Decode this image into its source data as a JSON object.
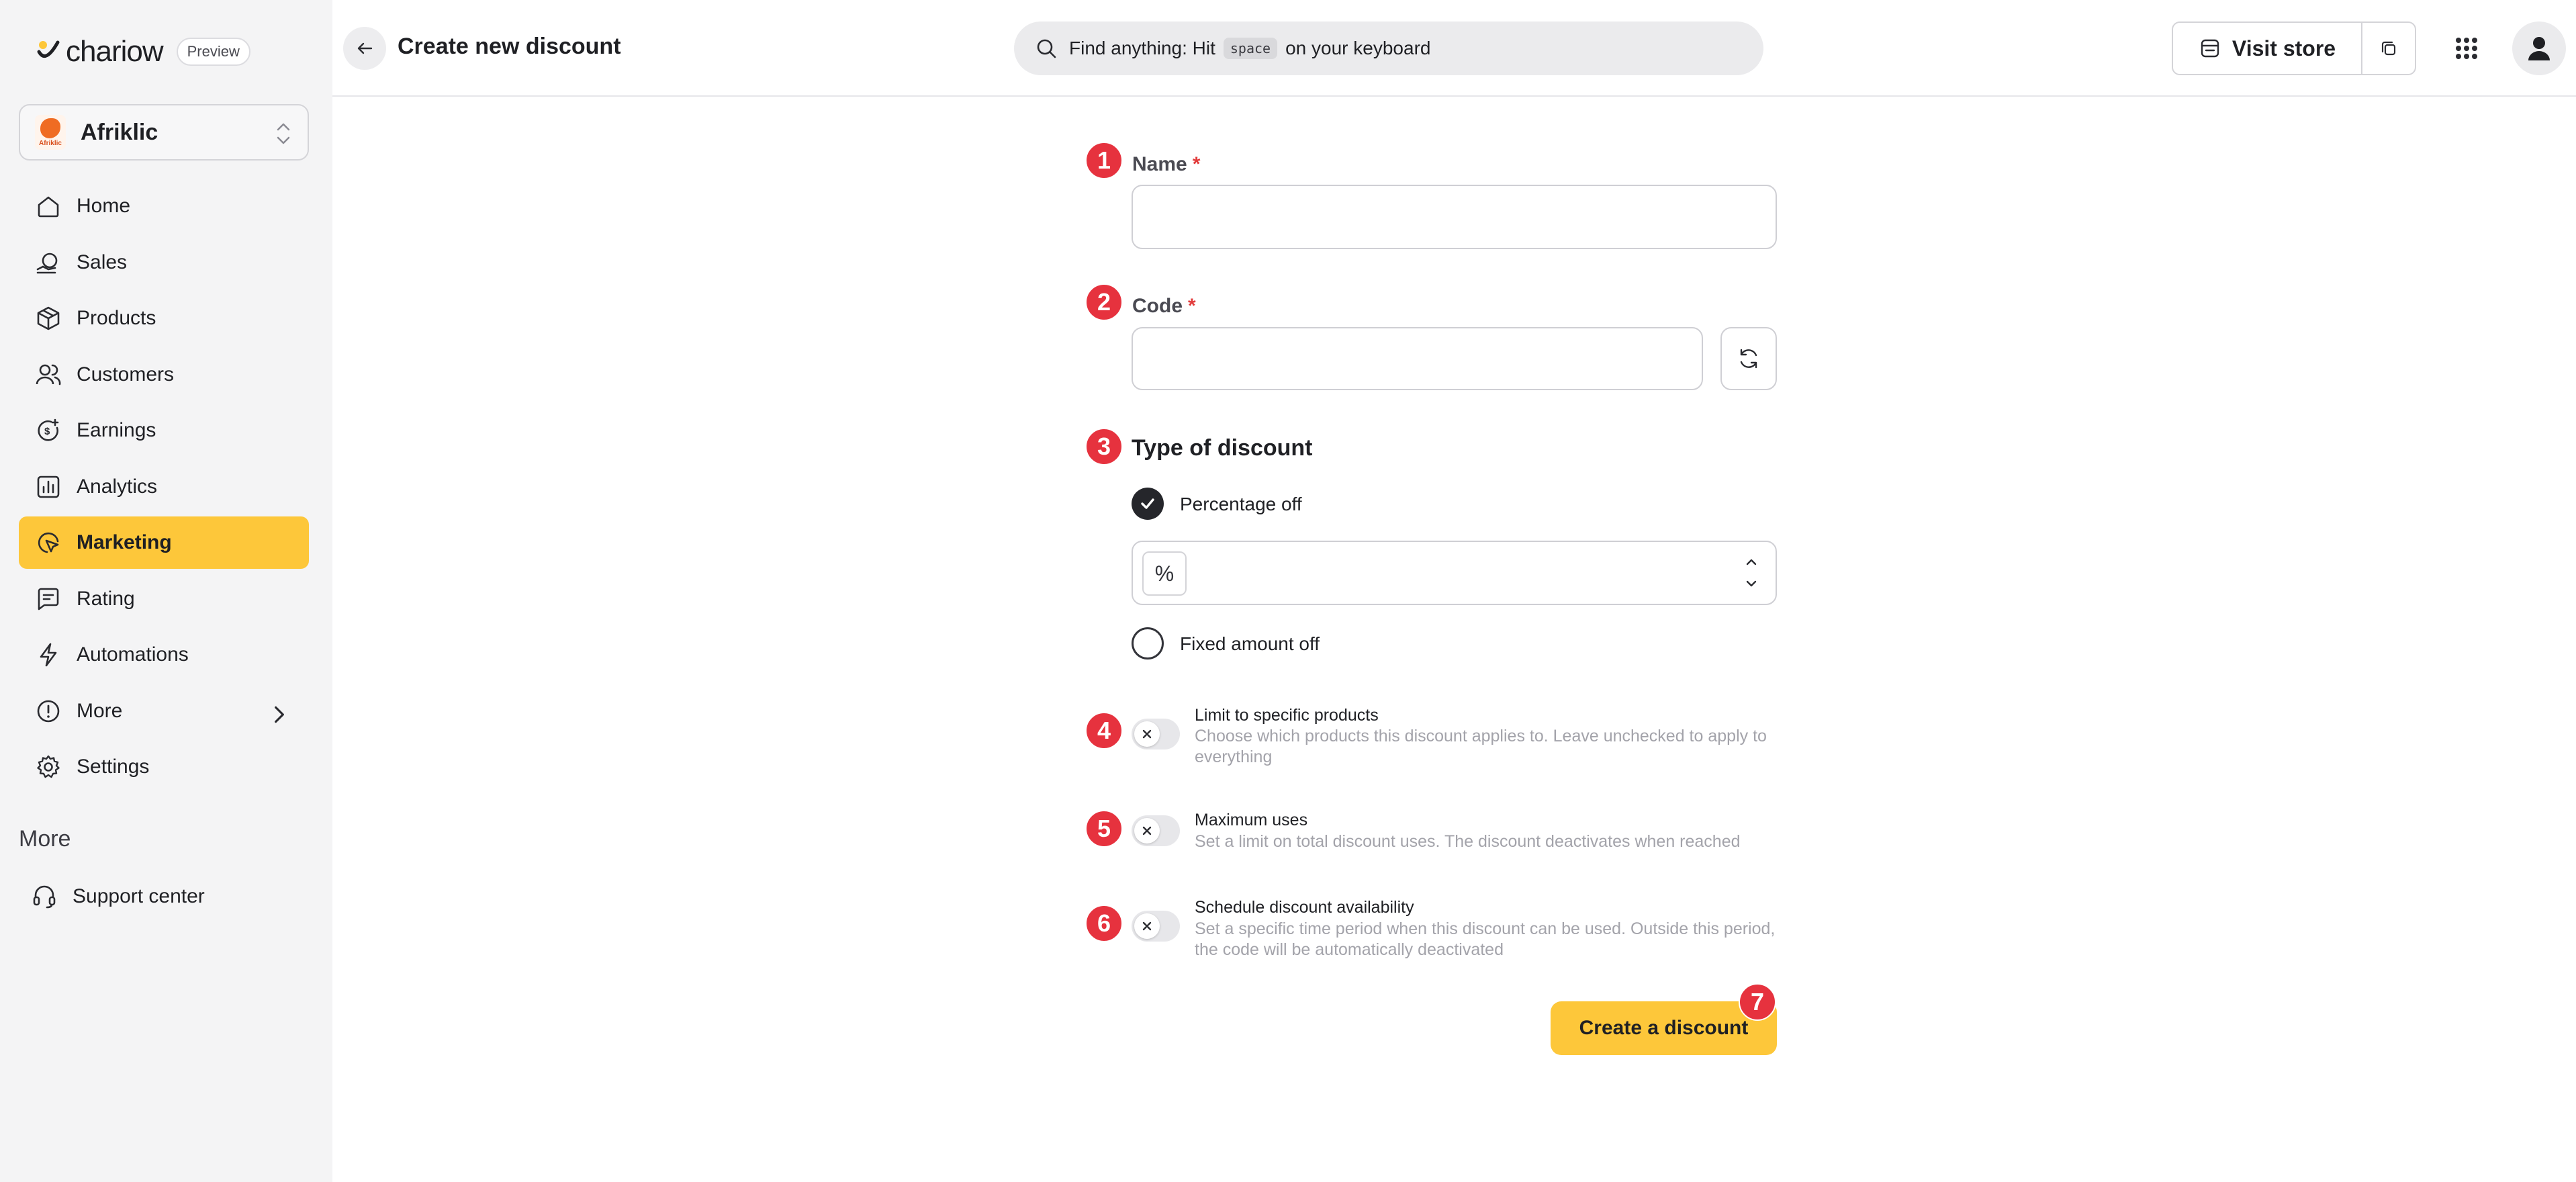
{
  "app": {
    "brand_name": "chariow",
    "preview_badge": "Preview",
    "store_name": "Afriklic",
    "store_logo_text": "Afriklic"
  },
  "sidebar": {
    "items": [
      {
        "label": "Home",
        "icon": "home-icon"
      },
      {
        "label": "Sales",
        "icon": "sales-icon"
      },
      {
        "label": "Products",
        "icon": "box-icon"
      },
      {
        "label": "Customers",
        "icon": "users-icon"
      },
      {
        "label": "Earnings",
        "icon": "earnings-icon"
      },
      {
        "label": "Analytics",
        "icon": "chart-icon"
      },
      {
        "label": "Marketing",
        "icon": "marketing-icon",
        "active": true
      },
      {
        "label": "Rating",
        "icon": "rating-icon"
      },
      {
        "label": "Automations",
        "icon": "bolt-icon"
      },
      {
        "label": "More",
        "icon": "info-icon",
        "has_submenu": true
      },
      {
        "label": "Settings",
        "icon": "gear-icon"
      }
    ],
    "section_title": "More",
    "support_label": "Support center"
  },
  "header": {
    "title": "Create new discount",
    "search_prefix": "Find anything: Hit",
    "search_key": "space",
    "search_suffix": "on your keyboard",
    "visit_store_label": "Visit store"
  },
  "form": {
    "name": {
      "step": "1",
      "label": "Name",
      "required_mark": "*",
      "value": ""
    },
    "code": {
      "step": "2",
      "label": "Code",
      "required_mark": "*",
      "value": ""
    },
    "type": {
      "step": "3",
      "title": "Type of discount",
      "options": [
        {
          "label": "Percentage off",
          "checked": true
        },
        {
          "label": "Fixed amount off",
          "checked": false
        }
      ],
      "percent_symbol": "%",
      "percent_value": ""
    },
    "options": [
      {
        "step": "4",
        "title": "Limit to specific products",
        "description": "Choose which products this discount applies to. Leave unchecked to apply to everything",
        "enabled": false
      },
      {
        "step": "5",
        "title": "Maximum uses",
        "description": "Set a limit on total discount uses. The discount deactivates when reached",
        "enabled": false
      },
      {
        "step": "6",
        "title": "Schedule discount availability",
        "description": "Set a specific time period when this discount can be used. Outside this period, the code will be automatically deactivated",
        "enabled": false
      }
    ],
    "submit": {
      "step": "7",
      "label": "Create a discount"
    }
  },
  "colors": {
    "accent": "#fdc73a",
    "step_badge": "#e6323e",
    "sidebar_bg": "#f4f4f5"
  }
}
